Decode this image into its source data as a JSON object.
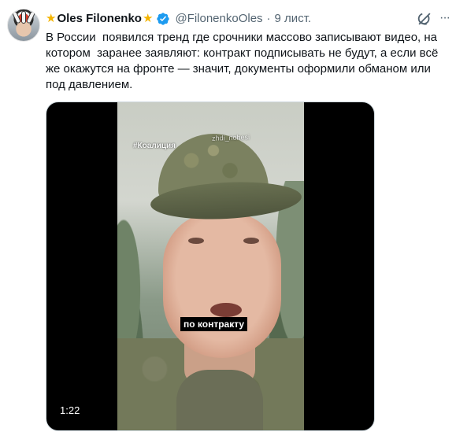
{
  "tweet": {
    "author_name": "Oles Filonenko",
    "handle": "@FilonenkoOles",
    "separator": "·",
    "date": "9 лист.",
    "badge_icon": "verified-badge-icon",
    "decoration_icon": "star-icon",
    "text": "В России  появился тренд где срочники массово записывают видео, на котором  заранее заявляют: контракт подписывать не будут, а если всё же окажутся на фронте — значит, документы оформили обманом или под давлением.",
    "colors": {
      "verified": "#1d9bf0",
      "star": "#f4b400",
      "secondary_text": "#536471"
    }
  },
  "video": {
    "watermark": "#Коалиция",
    "watermark_handle": "zhdi_nohesi",
    "caption": "по контракту",
    "duration": "1:22"
  },
  "actions": {
    "grok_icon": "grok-icon",
    "more_icon": "more-icon"
  }
}
